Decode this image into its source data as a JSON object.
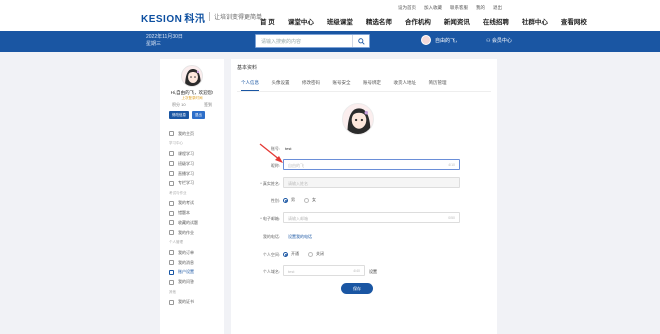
{
  "header": {
    "logo_latin": "KESION",
    "logo_cn": "科汛",
    "slogan": "让培训变得更简单",
    "nav": [
      "首 页",
      "课堂中心",
      "班级课堂",
      "精选名师",
      "合作机构",
      "新闻资讯",
      "在线招聘",
      "社群中心",
      "查看网校"
    ],
    "toplinks": [
      "设为首页",
      "加入收藏",
      "联系客服",
      "我的",
      "退出"
    ]
  },
  "banner": {
    "date_line1": "2022年11月30日",
    "date_line2": "星期三",
    "search_placeholder": "请输入搜索的内容",
    "username": "自由的飞，",
    "member_center": "会员中心"
  },
  "sidebar": {
    "name": "Hi,自由的飞，欢迎您!",
    "tag": "上次登录时间",
    "stat_left": "积分 10",
    "stat_right": "签到",
    "btn_edit": "修改信息",
    "btn_logout": "退出",
    "items": [
      {
        "label": "我的主页",
        "type": "item"
      },
      {
        "label": "学习中心",
        "type": "section"
      },
      {
        "label": "课程学习",
        "type": "item"
      },
      {
        "label": "班级学习",
        "type": "item"
      },
      {
        "label": "直播学习",
        "type": "item"
      },
      {
        "label": "专栏学习",
        "type": "item"
      },
      {
        "label": "考试与作业",
        "type": "section"
      },
      {
        "label": "我的考试",
        "type": "item"
      },
      {
        "label": "错题本",
        "type": "item"
      },
      {
        "label": "收藏的试题",
        "type": "item"
      },
      {
        "label": "我的作业",
        "type": "item"
      },
      {
        "label": "个人管理",
        "type": "section"
      },
      {
        "label": "我的订单",
        "type": "item"
      },
      {
        "label": "我的消息",
        "type": "item"
      },
      {
        "label": "账户设置",
        "type": "item",
        "active": true
      },
      {
        "label": "我的问答",
        "type": "item"
      },
      {
        "label": "其他",
        "type": "section"
      },
      {
        "label": "我的证书",
        "type": "item"
      }
    ]
  },
  "main": {
    "title": "基本资料",
    "tabs": [
      "个人信息",
      "头像设置",
      "修改密码",
      "账号安全",
      "账号绑定",
      "收货人地址",
      "简历管理"
    ],
    "fields": {
      "account_label": "账号:",
      "account_value": "test",
      "nickname_label": "昵称:",
      "nickname_placeholder": "自由的飞",
      "nickname_count": "4/10",
      "realname_label": "* 真实姓名:",
      "realname_placeholder": "请输入姓名",
      "gender_label": "性别:",
      "gender_male": "男",
      "gender_female": "女",
      "email_label": "* 电子邮箱:",
      "email_placeholder": "请输入邮箱",
      "email_count": "0/50",
      "phone_label": "我的电话:",
      "phone_link": "设置我的电话",
      "space_label": "个人空间:",
      "space_open": "开通",
      "space_close": "关闭",
      "domain_label": "个人域名:",
      "domain_placeholder": "test",
      "domain_count": "4/40",
      "domain_suffix": "设置",
      "save": "保存"
    }
  },
  "colors": {
    "brand": "#1a56a3",
    "background": "#f1f2f6"
  }
}
